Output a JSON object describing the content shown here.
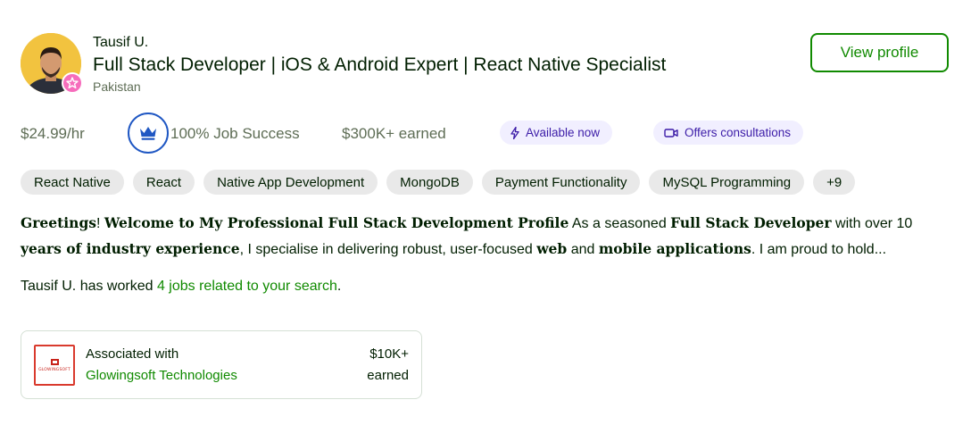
{
  "profile": {
    "name": "Tausif U.",
    "headline": "Full Stack Developer | iOS & Android Expert | React Native Specialist",
    "location": "Pakistan",
    "view_profile_label": "View profile"
  },
  "stats": {
    "rate": "$24.99/hr",
    "job_success": "100% Job Success",
    "earned": "$300K+ earned",
    "available": "Available now",
    "consultations": "Offers consultations"
  },
  "skills": [
    "React Native",
    "React",
    "Native App Development",
    "MongoDB",
    "Payment Functionality",
    "MySQL Programming",
    "+9"
  ],
  "description": {
    "p1": "Greetings",
    "p2": "! ",
    "p3": "Welcome to My Professional Full Stack Development Profile",
    "p4": " As a seasoned ",
    "p5": "Full Stack Developer",
    "p6": " with over 10 ",
    "p7": "years of industry experience",
    "p8": ", I specialise in delivering robust, user-focused ",
    "p9": "web",
    "p10": " and ",
    "p11": "mobile applications",
    "p12": ". I am proud to hold..."
  },
  "worked": {
    "prefix": "Tausif U. has worked ",
    "link": "4 jobs related to your search",
    "suffix": "."
  },
  "agency": {
    "label": "Associated with",
    "name": "Glowingsoft Technologies",
    "amount": "$10K+",
    "earned_label": "earned",
    "logo_text": "GLOWINGSOFT"
  },
  "colors": {
    "brand_green": "#108a00",
    "jss_blue": "#1f57c3",
    "badge_pink": "#f66dbc",
    "pill_purple_bg": "#f1efff",
    "pill_purple_text": "#3c1ca8"
  },
  "icons": {
    "badge": "star-badge-icon",
    "jss": "crown-icon",
    "available": "lightning-icon",
    "consult": "video-camera-icon"
  }
}
